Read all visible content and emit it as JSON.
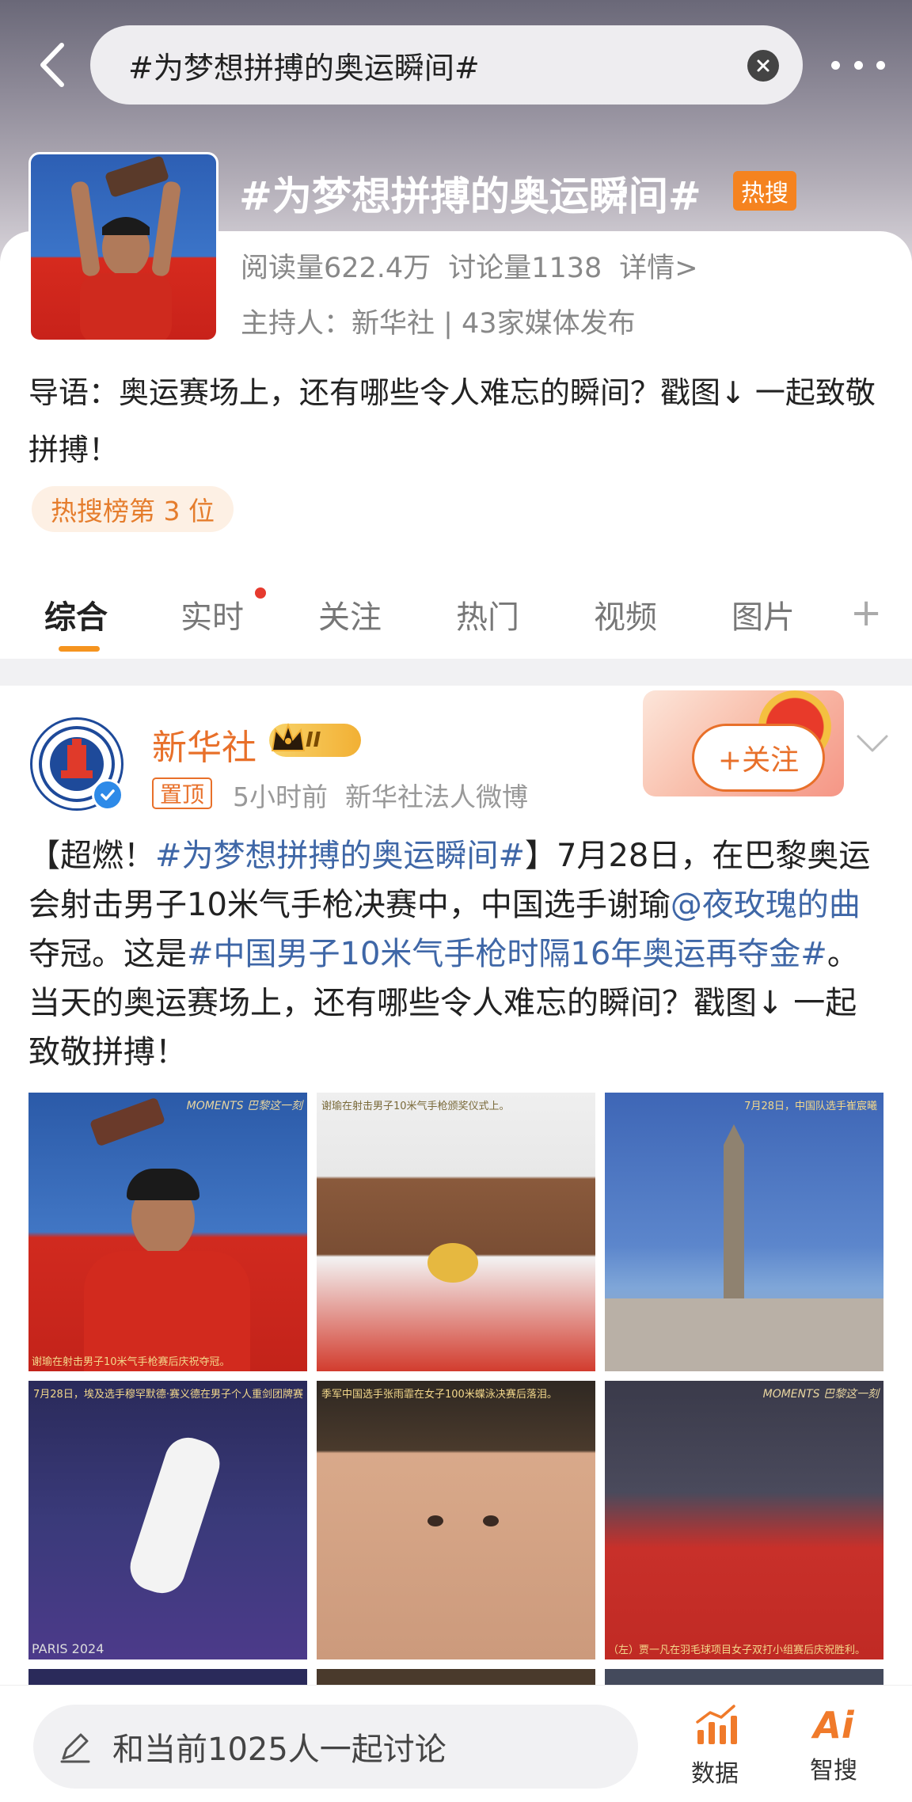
{
  "search": {
    "value": "#为梦想拼搏的奥运瞬间#"
  },
  "topic": {
    "title": "#为梦想拼搏的奥运瞬间#",
    "hot_badge": "热搜",
    "reads": "阅读量622.4万",
    "discussions": "讨论量1138",
    "details_link": "详情>",
    "host": "主持人：新华社 | 43家媒体发布",
    "intro": "导语：奥运赛场上，还有哪些令人难忘的瞬间？戳图↓ 一起致敬拼搏！",
    "rank": "热搜榜第 3 位"
  },
  "tabs": [
    {
      "label": "综合"
    },
    {
      "label": "实时"
    },
    {
      "label": "关注"
    },
    {
      "label": "热门"
    },
    {
      "label": "视频"
    },
    {
      "label": "图片"
    }
  ],
  "tab_plus": "+",
  "post": {
    "author": "新华社",
    "vip_level": "II",
    "pinned": "置顶",
    "time": "5小时前",
    "source": "新华社法人微博",
    "follow": "+关注",
    "text": {
      "p1": "【超燃！",
      "tag1": "#为梦想拼搏的奥运瞬间#",
      "p2": "】7月28日，在巴黎奥运会射击男子10米气手枪决赛中，中国选手谢瑜",
      "mention": "@夜玫瑰的曲",
      "p3": " 夺冠。这是",
      "tag2": "#中国男子10米气手枪时隔16年奥运再夺金#",
      "p4": "。当天的奥运赛场上，还有哪些令人难忘的瞬间？戳图↓ 一起致敬拼搏！"
    },
    "photos": {
      "c1": "谢瑜在射击男子10米气手枪赛后庆祝夺冠。",
      "t2": "谢瑜在射击男子10米气手枪颁奖仪式上。",
      "t3": "7月28日，中国队选手崔宸曦",
      "t4": "7月28日，埃及选手穆罕默德·赛义德在男子个人重剑团牌赛",
      "t5": "季军中国选手张雨霏在女子100米蝶泳决赛后落泪。",
      "c6": "（左）贾一凡在羽毛球项目女子双打小组赛后庆祝胜利。",
      "brand": "MOMENTS 巴黎这一刻",
      "paris": "PARIS 2024"
    }
  },
  "bottom": {
    "discuss": "和当前1025人一起讨论",
    "data_label": "数据",
    "ai_label": "智搜",
    "ai_icon_text": "Ai"
  },
  "colors": {
    "accent": "#e8702a",
    "link": "#3f67a7",
    "hot": "#f5831f"
  }
}
